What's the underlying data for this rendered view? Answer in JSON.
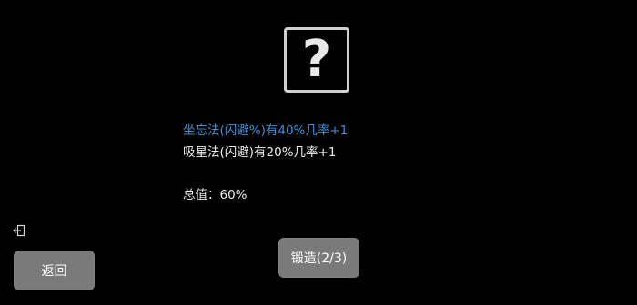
{
  "mystery": {
    "icon": "question-mark-icon",
    "glyph": "?"
  },
  "effects": [
    {
      "text": "坐忘法(闪避%)有40%几率+1",
      "color": "#3d8fd6"
    },
    {
      "text": "吸星法(闪避)有20%几率+1",
      "color": "#ededed"
    }
  ],
  "total": {
    "text": "总值：60%"
  },
  "buttons": {
    "back_label": "返回",
    "forge_label": "锻造(2/3)"
  },
  "icons": {
    "exit": "exit-icon"
  },
  "colors": {
    "background": "#000000",
    "button": "#7a7a7a",
    "highlight": "#3d8fd6"
  }
}
